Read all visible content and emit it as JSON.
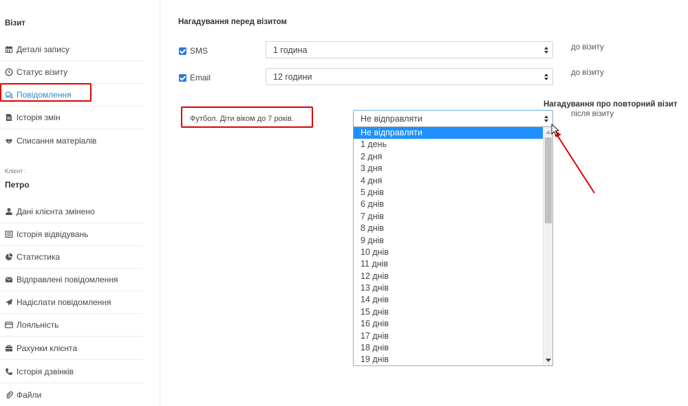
{
  "sidebar": {
    "visit_heading": "Візит",
    "visit_items": [
      {
        "label": "Деталі запису",
        "icon": "calendar-icon"
      },
      {
        "label": "Статус візиту",
        "icon": "clock-icon"
      },
      {
        "label": "Повідомлення",
        "icon": "comments-icon"
      },
      {
        "label": "Історія змін",
        "icon": "file-icon"
      },
      {
        "label": "Списання матеріалів",
        "icon": "handshake-icon"
      }
    ],
    "client_caption": "Клієнт :",
    "client_name": "Петро",
    "client_items": [
      {
        "label": "Дані клієнта змінено",
        "icon": "user-icon"
      },
      {
        "label": "Історія відвідувань",
        "icon": "list-icon"
      },
      {
        "label": "Статистика",
        "icon": "pie-chart-icon"
      },
      {
        "label": "Відправлені повідомлення",
        "icon": "envelope-icon"
      },
      {
        "label": "Надіслати повідомлення",
        "icon": "paper-plane-icon"
      },
      {
        "label": "Лояльність",
        "icon": "credit-card-icon"
      },
      {
        "label": "Рахунки клієнта",
        "icon": "briefcase-icon"
      },
      {
        "label": "Історія дзвінків",
        "icon": "phone-icon"
      },
      {
        "label": "Файли",
        "icon": "paperclip-icon"
      }
    ]
  },
  "main": {
    "reminder_title": "Нагадування перед візитом",
    "sms": {
      "label": "SMS",
      "checked": true,
      "value": "1 година",
      "note": "до візиту"
    },
    "email": {
      "label": "Email",
      "checked": true,
      "value": "12 години",
      "note": "до візиту"
    },
    "repeat_title": "Нагадування про повторний візит",
    "service_label": "Футбол. Діти віком до 7 років.",
    "repeat_select": {
      "value": "Не відправляти",
      "note": "після візиту"
    },
    "dropdown_options": [
      "Не відправляти",
      "1 день",
      "2 дня",
      "3 дня",
      "4 дня",
      "5 днів",
      "6 днів",
      "7 днів",
      "8 днів",
      "9 днів",
      "10 днів",
      "11 днів",
      "12 днів",
      "13 днів",
      "14 днів",
      "15 днів",
      "16 днів",
      "17 днів",
      "18 днів",
      "19 днів"
    ],
    "dropdown_selected_index": 0
  },
  "colors": {
    "accent": "#2a88c9",
    "highlight_box": "#e00000",
    "selected_option": "#1e90ff",
    "checkbox": "#2a7ad5"
  }
}
